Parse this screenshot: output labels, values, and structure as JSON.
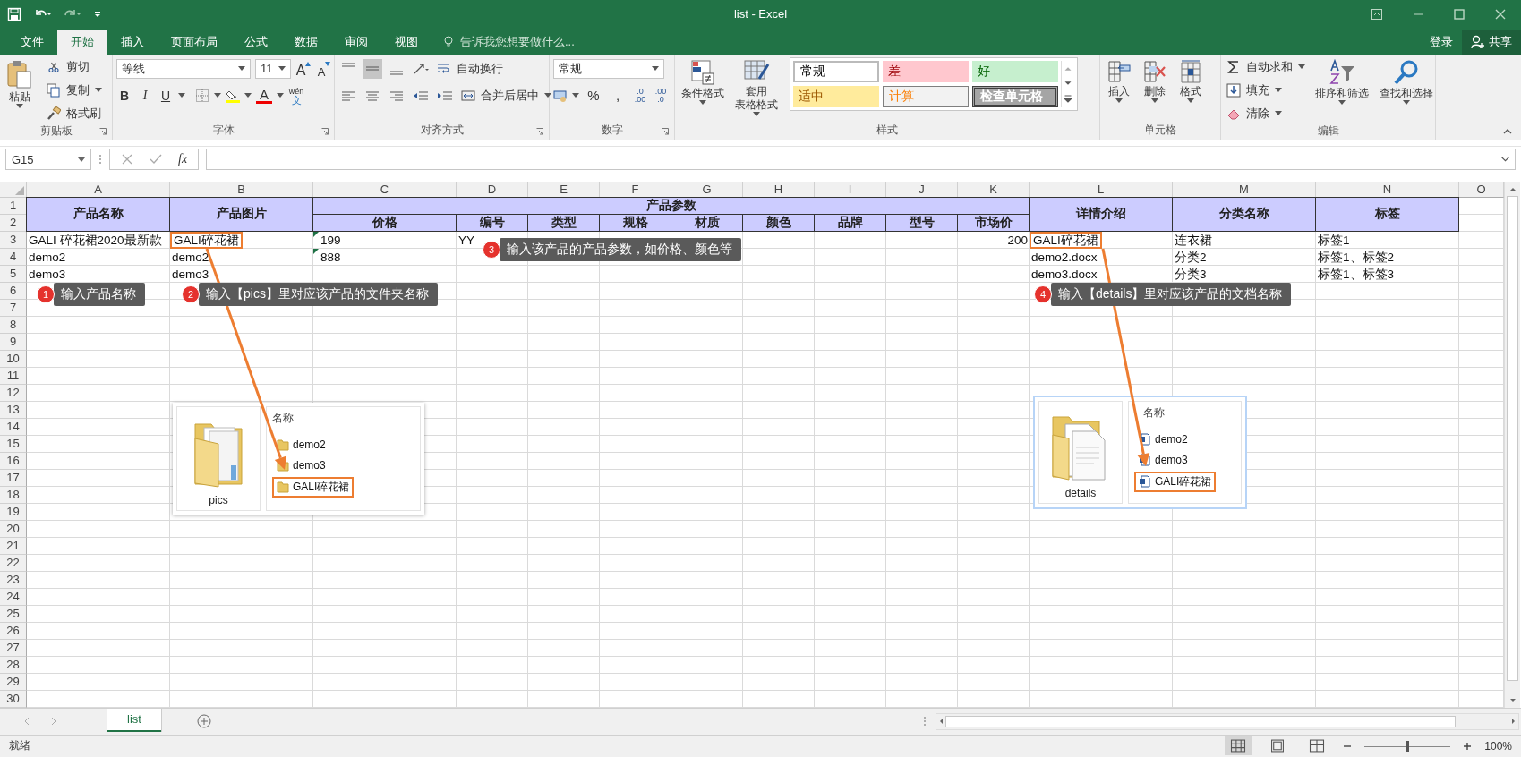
{
  "window": {
    "title": "list - Excel"
  },
  "ribbon_tabs": [
    {
      "label": "文件",
      "selected": false
    },
    {
      "label": "开始",
      "selected": true
    },
    {
      "label": "插入",
      "selected": false
    },
    {
      "label": "页面布局",
      "selected": false
    },
    {
      "label": "公式",
      "selected": false
    },
    {
      "label": "数据",
      "selected": false
    },
    {
      "label": "审阅",
      "selected": false
    },
    {
      "label": "视图",
      "selected": false
    }
  ],
  "tell_me": {
    "placeholder": "告诉我您想要做什么..."
  },
  "account": {
    "sign_in": "登录",
    "share": "共享"
  },
  "clipboard": {
    "title": "剪贴板",
    "paste": "粘贴",
    "cut": "剪切",
    "copy": "复制",
    "format_painter": "格式刷"
  },
  "font": {
    "title": "字体",
    "font_name": "等线",
    "font_size": "11",
    "grow_font": "A",
    "shrink_font": "A",
    "bold": "B",
    "italic": "I",
    "underline": "U",
    "font_color": "A",
    "phonetic": "wén",
    "phonetic_char": "文"
  },
  "alignment": {
    "title": "对齐方式",
    "align_middle_on": true,
    "wrap_text": "自动换行",
    "merge_center": "合并后居中"
  },
  "number": {
    "title": "数字",
    "format": "常规",
    "percent": "%",
    "comma": ",",
    "increase_decimal": [
      ".0",
      ".00"
    ],
    "decrease_decimal": [
      ".00",
      ".0"
    ]
  },
  "styles": {
    "title": "样式",
    "conditional_format": "条件格式",
    "table_format": [
      "套用",
      "表格格式"
    ],
    "cell_styles": [
      {
        "label": "常规",
        "kind": "normal"
      },
      {
        "label": "差",
        "kind": "bad"
      },
      {
        "label": "好",
        "kind": "good"
      },
      {
        "label": "适中",
        "kind": "neutral"
      },
      {
        "label": "计算",
        "kind": "calculation"
      },
      {
        "label": "检查单元格",
        "kind": "check"
      }
    ]
  },
  "cells": {
    "title": "单元格",
    "insert": "插入",
    "delete": "删除",
    "format": "格式"
  },
  "editing": {
    "title": "编辑",
    "autosum": "自动求和",
    "fill": "填充",
    "clear": "清除",
    "sort_filter": "排序和筛选",
    "find_select": "查找和选择"
  },
  "formula_bar": {
    "name_box": "G15",
    "function_label": "fx"
  },
  "sheet": {
    "columns": [
      "A",
      "B",
      "C",
      "D",
      "E",
      "F",
      "G",
      "H",
      "I",
      "J",
      "K",
      "L",
      "M",
      "N",
      "O"
    ],
    "row_numbers": [
      "1",
      "2",
      "3",
      "4",
      "5",
      "6",
      "7",
      "8",
      "9",
      "10",
      "11",
      "12",
      "13",
      "14",
      "15",
      "16",
      "17",
      "18",
      "19",
      "20",
      "21",
      "22",
      "23",
      "24",
      "25",
      "26",
      "27",
      "28",
      "29",
      "30"
    ],
    "header_cells": [
      {
        "text": "产品名称"
      },
      {
        "text": "产品图片"
      },
      {
        "text": "产品参数"
      },
      {
        "text": "价格"
      },
      {
        "text": "编号"
      },
      {
        "text": "类型"
      },
      {
        "text": "规格"
      },
      {
        "text": "材质"
      },
      {
        "text": "颜色"
      },
      {
        "text": "品牌"
      },
      {
        "text": "型号"
      },
      {
        "text": "市场价"
      },
      {
        "text": "详情介绍"
      },
      {
        "text": "分类名称"
      },
      {
        "text": "标签"
      }
    ],
    "rows": [
      {
        "cells": [
          {
            "text": "GALI 碎花裙2020最新款",
            "kind": "text",
            "outlined": false,
            "error_flag": false
          },
          {
            "text": "GALI碎花裙",
            "kind": "text",
            "outlined": true,
            "error_flag": false
          },
          {
            "text": "199",
            "kind": "text",
            "outlined": false,
            "error_flag": true
          },
          {
            "text": "YY",
            "kind": "text",
            "outlined": false,
            "error_flag": false
          },
          "",
          "",
          "",
          "",
          "",
          "",
          {
            "text": "200",
            "kind": "number",
            "outlined": false,
            "error_flag": false
          },
          {
            "text": "GALI碎花裙",
            "kind": "text",
            "outlined": true,
            "error_flag": false
          },
          {
            "text": "连衣裙",
            "kind": "text",
            "outlined": false,
            "error_flag": false
          },
          {
            "text": "标签1",
            "kind": "text",
            "outlined": false,
            "error_flag": false
          }
        ]
      },
      {
        "cells": [
          {
            "text": "demo2",
            "kind": "text",
            "outlined": false,
            "error_flag": false
          },
          {
            "text": "demo2",
            "kind": "text",
            "outlined": false,
            "error_flag": false
          },
          {
            "text": "888",
            "kind": "text",
            "outlined": false,
            "error_flag": true
          },
          "",
          "",
          "",
          "",
          "",
          "",
          "",
          "",
          {
            "text": "demo2.docx",
            "kind": "text",
            "outlined": false,
            "error_flag": false
          },
          {
            "text": "分类2",
            "kind": "text",
            "outlined": false,
            "error_flag": false
          },
          {
            "text": "标签1、标签2",
            "kind": "text",
            "outlined": false,
            "error_flag": false
          }
        ]
      },
      {
        "cells": [
          {
            "text": "demo3",
            "kind": "text",
            "outlined": false,
            "error_flag": false
          },
          {
            "text": "demo3",
            "kind": "text",
            "outlined": false,
            "error_flag": false
          },
          "",
          "",
          "",
          "",
          "",
          "",
          "",
          "",
          "",
          {
            "text": "demo3.docx",
            "kind": "text",
            "outlined": false,
            "error_flag": false
          },
          {
            "text": "分类3",
            "kind": "text",
            "outlined": false,
            "error_flag": false
          },
          {
            "text": "标签1、标签3",
            "kind": "text",
            "outlined": false,
            "error_flag": false
          }
        ]
      }
    ]
  },
  "callouts": [
    {
      "number": "1",
      "text": "输入产品名称"
    },
    {
      "number": "2",
      "text": "输入【pics】里对应该产品的文件夹名称"
    },
    {
      "number": "3",
      "text": "输入该产品的产品参数，如价格、颜色等"
    },
    {
      "number": "4",
      "text": "输入【details】里对应该产品的文档名称"
    }
  ],
  "folder_popups": [
    {
      "folder_name": "pics",
      "kind": "folder",
      "column_header": "名称",
      "items": [
        {
          "name": "demo2",
          "selected": false
        },
        {
          "name": "demo3",
          "selected": false
        },
        {
          "name": "GALI碎花裙",
          "selected": true
        }
      ]
    },
    {
      "folder_name": "details",
      "kind": "document",
      "column_header": "名称",
      "items": [
        {
          "name": "demo2",
          "selected": false
        },
        {
          "name": "demo3",
          "selected": false
        },
        {
          "name": "GALI碎花裙",
          "selected": true
        }
      ]
    }
  ],
  "sheet_tabs": [
    {
      "label": "list",
      "selected": true
    }
  ],
  "status_bar": {
    "status": "就绪",
    "zoom": {
      "level": 0.5,
      "reading": "100%"
    }
  }
}
